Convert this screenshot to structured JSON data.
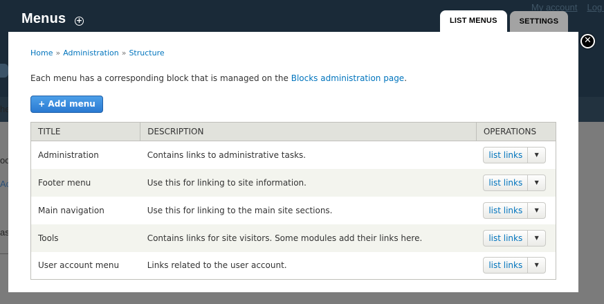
{
  "background": {
    "top_links": [
      "My account",
      "Log out"
    ],
    "edge_texts": [
      "he",
      "oo",
      "Ac",
      "as"
    ]
  },
  "header": {
    "title": "Menus",
    "shortcut_glyph": "+",
    "tabs": [
      {
        "label": "List menus",
        "active": true
      },
      {
        "label": "Settings",
        "active": false
      }
    ]
  },
  "dialog": {
    "close_glyph": "✕",
    "breadcrumb": [
      "Home",
      "Administration",
      "Structure"
    ],
    "breadcrumb_separator": "»",
    "intro": {
      "before_link": "Each menu has a corresponding block that is managed on the ",
      "link": "Blocks administration page",
      "after_link": "."
    },
    "add_button_label": "+ Add menu",
    "table": {
      "headers": [
        "Title",
        "Description",
        "Operations"
      ],
      "rows": [
        {
          "title": "Administration",
          "description": "Contains links to administrative tasks.",
          "operation": "list links"
        },
        {
          "title": "Footer menu",
          "description": "Use this for linking to site information.",
          "operation": "list links"
        },
        {
          "title": "Main navigation",
          "description": "Use this for linking to the main site sections.",
          "operation": "list links"
        },
        {
          "title": "Tools",
          "description": "Contains links for site visitors. Some modules add their links here.",
          "operation": "list links"
        },
        {
          "title": "User account menu",
          "description": "Links related to the user account.",
          "operation": "list links"
        }
      ],
      "toggle_glyph": "▼"
    }
  },
  "colors": {
    "link": "#0074bd",
    "primary_button": "#2a7ad2",
    "header_bg": "#1a2a38",
    "table_header_bg": "#e1e2dc",
    "row_alt_bg": "#f3f4ee"
  }
}
